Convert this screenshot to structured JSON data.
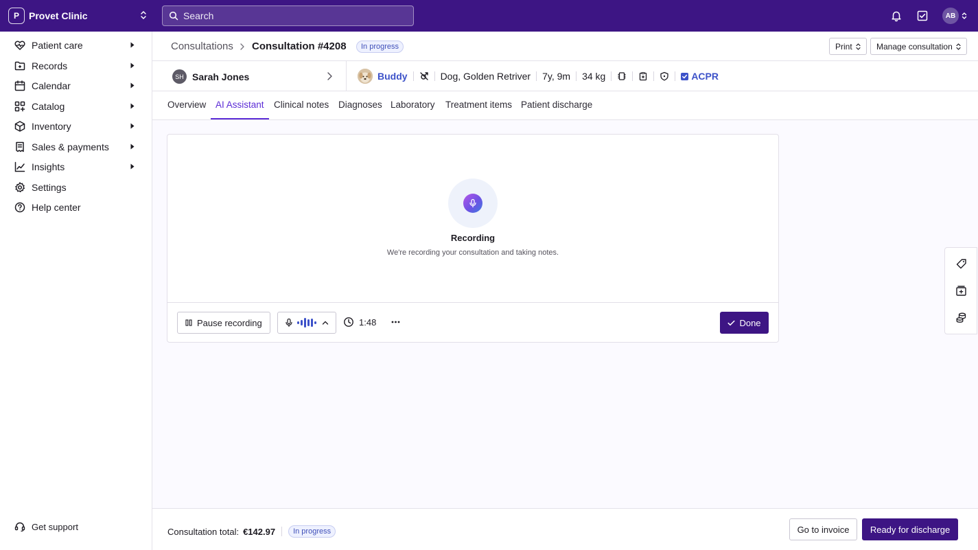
{
  "app": {
    "clinic_initial": "P",
    "clinic_name": "Provet Clinic",
    "search_placeholder": "Search",
    "user_initials": "AB"
  },
  "sidebar": {
    "items": [
      {
        "label": "Patient care",
        "icon": "heart-pulse-icon",
        "expandable": true
      },
      {
        "label": "Records",
        "icon": "folder-icon",
        "expandable": true
      },
      {
        "label": "Calendar",
        "icon": "calendar-icon",
        "expandable": true
      },
      {
        "label": "Catalog",
        "icon": "grid-plus-icon",
        "expandable": true
      },
      {
        "label": "Inventory",
        "icon": "box-icon",
        "expandable": true
      },
      {
        "label": "Sales & payments",
        "icon": "receipt-icon",
        "expandable": true
      },
      {
        "label": "Insights",
        "icon": "line-chart-icon",
        "expandable": true
      },
      {
        "label": "Settings",
        "icon": "gear-icon",
        "expandable": false
      },
      {
        "label": "Help center",
        "icon": "help-circle-icon",
        "expandable": false
      }
    ],
    "support_label": "Get support"
  },
  "header": {
    "breadcrumb_root": "Consultations",
    "title": "Consultation #4208",
    "status": "In progress",
    "print_label": "Print",
    "manage_label": "Manage consultation"
  },
  "patient": {
    "owner_initials": "SH",
    "owner_name": "Sarah Jones",
    "pet_name": "Buddy",
    "species": "Dog, Golden Retriver",
    "age": "7y, 9m",
    "weight": "34 kg",
    "flag_label": "ACPR"
  },
  "tabs": [
    {
      "label": "Overview",
      "active": false
    },
    {
      "label": "AI Assistant",
      "active": true
    },
    {
      "label": "Clinical notes",
      "active": false
    },
    {
      "label": "Diagnoses",
      "active": false
    },
    {
      "label": "Laboratory",
      "active": false
    },
    {
      "label": "Treatment items",
      "active": false
    },
    {
      "label": "Patient discharge",
      "active": false
    }
  ],
  "recording": {
    "title": "Recording",
    "subtitle": "We're recording your consultation and taking notes.",
    "pause_label": "Pause recording",
    "timer": "1:48",
    "done_label": "Done"
  },
  "footer": {
    "total_label": "Consultation total:",
    "total_amount": "€142.97",
    "status": "In progress",
    "invoice_label": "Go to invoice",
    "discharge_label": "Ready for discharge"
  },
  "colors": {
    "brand": "#3d1584",
    "accent": "#5b2bd6",
    "link": "#3d52c9"
  }
}
